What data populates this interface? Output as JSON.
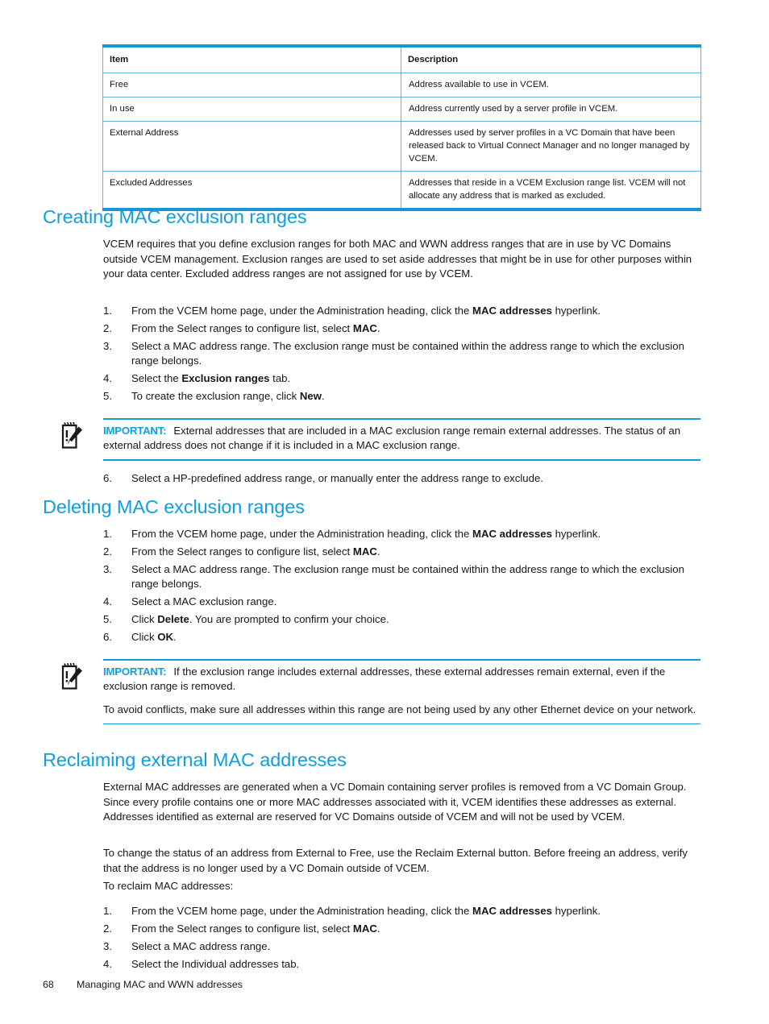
{
  "table": {
    "headers": [
      "Item",
      "Description"
    ],
    "rows": [
      [
        "Free",
        "Address available to use in VCEM."
      ],
      [
        "In use",
        "Address currently used by a server profile in VCEM."
      ],
      [
        "External Address",
        "Addresses used by server profiles in a VC Domain that have been released back to Virtual Connect Manager and no longer managed by VCEM."
      ],
      [
        "Excluded Addresses",
        "Addresses that reside in a VCEM Exclusion range list. VCEM will not allocate any address that is marked as excluded."
      ]
    ]
  },
  "sections": {
    "creating": {
      "heading": "Creating MAC exclusion ranges",
      "intro": "VCEM requires that you define exclusion ranges for both MAC and WWN address ranges that are in use by VC Domains outside VCEM management. Exclusion ranges are used to set aside addresses that might be in use for other purposes within your data center. Excluded address ranges are not assigned for use by VCEM.",
      "steps": [
        {
          "num": "1.",
          "pre": "From the VCEM home page, under the Administration heading, click the ",
          "bold": "MAC addresses",
          "post": " hyperlink."
        },
        {
          "num": "2.",
          "pre": "From the Select ranges to configure list, select ",
          "bold": "MAC",
          "post": "."
        },
        {
          "num": "3.",
          "pre": "Select a MAC address range. The exclusion range must be contained within the address range to which the exclusion range belongs.",
          "bold": "",
          "post": ""
        },
        {
          "num": "4.",
          "pre": "Select the ",
          "bold": "Exclusion ranges",
          "post": " tab."
        },
        {
          "num": "5.",
          "pre": "To create the exclusion range, click ",
          "bold": "New",
          "post": "."
        }
      ],
      "note": {
        "label": "IMPORTANT:",
        "text": "External addresses that are included in a MAC exclusion range remain external addresses. The status of an external address does not change if it is included in a MAC exclusion range.",
        "icon": "important-notepad-icon"
      },
      "step6": {
        "num": "6.",
        "pre": "Select a HP-predefined address range, or manually enter the address range to exclude.",
        "bold": "",
        "post": ""
      }
    },
    "deleting": {
      "heading": "Deleting MAC exclusion ranges",
      "steps": [
        {
          "num": "1.",
          "pre": "From the VCEM home page, under the Administration heading, click the ",
          "bold": "MAC addresses",
          "post": " hyperlink."
        },
        {
          "num": "2.",
          "pre": "From the Select ranges to configure list, select ",
          "bold": "MAC",
          "post": "."
        },
        {
          "num": "3.",
          "pre": "Select a MAC address range. The exclusion range must be contained within the address range to which the exclusion range belongs.",
          "bold": "",
          "post": ""
        },
        {
          "num": "4.",
          "pre": "Select a MAC exclusion range.",
          "bold": "",
          "post": ""
        },
        {
          "num": "5.",
          "pre": "Click ",
          "bold": "Delete",
          "post": ". You are prompted to confirm your choice."
        },
        {
          "num": "6.",
          "pre": "Click ",
          "bold": "OK",
          "post": "."
        }
      ],
      "note": {
        "label": "IMPORTANT:",
        "text": "If the exclusion range includes external addresses, these external addresses remain external, even if the exclusion range is removed.",
        "text2": "To avoid conflicts, make sure all addresses within this range are not being used by any other Ethernet device on your network.",
        "icon": "important-notepad-icon"
      }
    },
    "reclaiming": {
      "heading": "Reclaiming external MAC addresses",
      "para1": "External MAC addresses are generated when a VC Domain containing server profiles is removed from a VC Domain Group. Since every profile contains one or more MAC addresses associated with it, VCEM identifies these addresses as external. Addresses identified as external are reserved for VC Domains outside of VCEM and will not be used by VCEM.",
      "para2": "To change the status of an address from External to Free, use the Reclaim External button. Before freeing an address, verify that the address is no longer used by a VC Domain outside of VCEM.",
      "para3": "To reclaim MAC addresses:",
      "steps": [
        {
          "num": "1.",
          "pre": "From the VCEM home page, under the Administration heading, click the ",
          "bold": "MAC addresses",
          "post": " hyperlink."
        },
        {
          "num": "2.",
          "pre": "From the Select ranges to configure list, select ",
          "bold": "MAC",
          "post": "."
        },
        {
          "num": "3.",
          "pre": "Select a MAC address range.",
          "bold": "",
          "post": ""
        },
        {
          "num": "4.",
          "pre": "Select the Individual addresses tab.",
          "bold": "",
          "post": ""
        }
      ]
    }
  },
  "footer": {
    "page_number": "68",
    "chapter": "Managing MAC and WWN addresses"
  },
  "colors": {
    "heading_blue": "#0e9fe0",
    "table_border_blue": "#1896d3",
    "rule_blue": "#1a9ad8",
    "text": "#17171a"
  }
}
